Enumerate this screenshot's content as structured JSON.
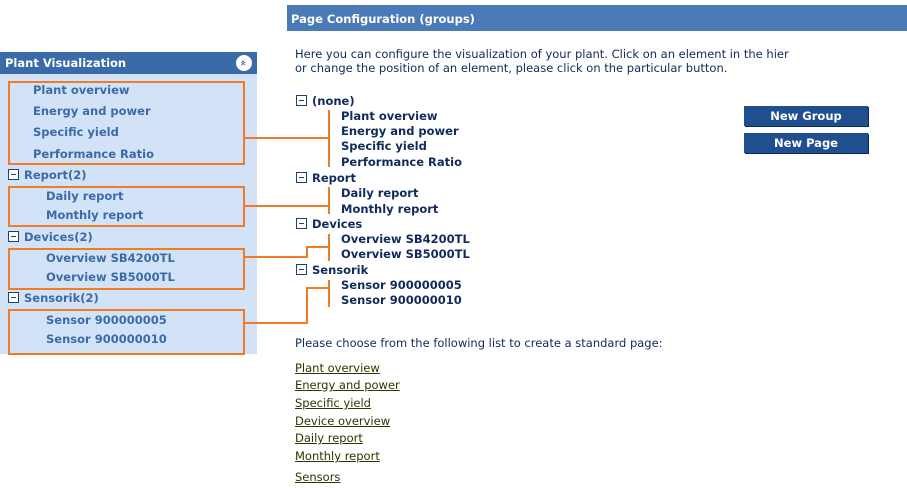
{
  "sidebar": {
    "title": "Plant Visualization",
    "collapse_glyph": "»",
    "items": [
      {
        "label": "Plant overview"
      },
      {
        "label": "Energy and power"
      },
      {
        "label": "Specific yield"
      },
      {
        "label": "Performance Ratio"
      }
    ],
    "groups": [
      {
        "label": "Report(2)",
        "items": [
          {
            "label": "Daily report"
          },
          {
            "label": "Monthly report"
          }
        ]
      },
      {
        "label": "Devices(2)",
        "items": [
          {
            "label": "Overview SB4200TL"
          },
          {
            "label": "Overview SB5000TL"
          }
        ]
      },
      {
        "label": "Sensorik(2)",
        "items": [
          {
            "label": "Sensor 900000005"
          },
          {
            "label": "Sensor 900000010"
          }
        ]
      }
    ]
  },
  "main": {
    "title": "Page Configuration (groups)",
    "intro_line1": "Here you can configure the visualization of your plant. Click on an element in the hier",
    "intro_line2": "or change the position of an element, please click on the particular button.",
    "tree": [
      {
        "label": "(none)",
        "items": [
          {
            "label": "Plant overview"
          },
          {
            "label": "Energy and power"
          },
          {
            "label": "Specific yield"
          },
          {
            "label": "Performance Ratio"
          }
        ]
      },
      {
        "label": "Report",
        "items": [
          {
            "label": "Daily report"
          },
          {
            "label": "Monthly report"
          }
        ]
      },
      {
        "label": "Devices",
        "items": [
          {
            "label": "Overview SB4200TL"
          },
          {
            "label": "Overview SB5000TL"
          }
        ]
      },
      {
        "label": "Sensorik",
        "items": [
          {
            "label": "Sensor 900000005"
          },
          {
            "label": "Sensor 900000010"
          }
        ]
      }
    ],
    "new_group_label": "New Group",
    "new_page_label": "New Page",
    "choose_text": "Please choose from the following list to create a standard page:",
    "standard_pages": [
      {
        "label": "Plant overview"
      },
      {
        "label": "Energy and power"
      },
      {
        "label": "Specific yield"
      },
      {
        "label": "Device overview"
      },
      {
        "label": "Daily report"
      },
      {
        "label": "Monthly report"
      },
      {
        "label": "Sensors"
      }
    ]
  },
  "colors": {
    "header_blue": "#3b6aa8",
    "sidebar_bg": "#d3e3f7",
    "highlight_orange": "#f07c28",
    "button_blue": "#1f4f8f"
  }
}
